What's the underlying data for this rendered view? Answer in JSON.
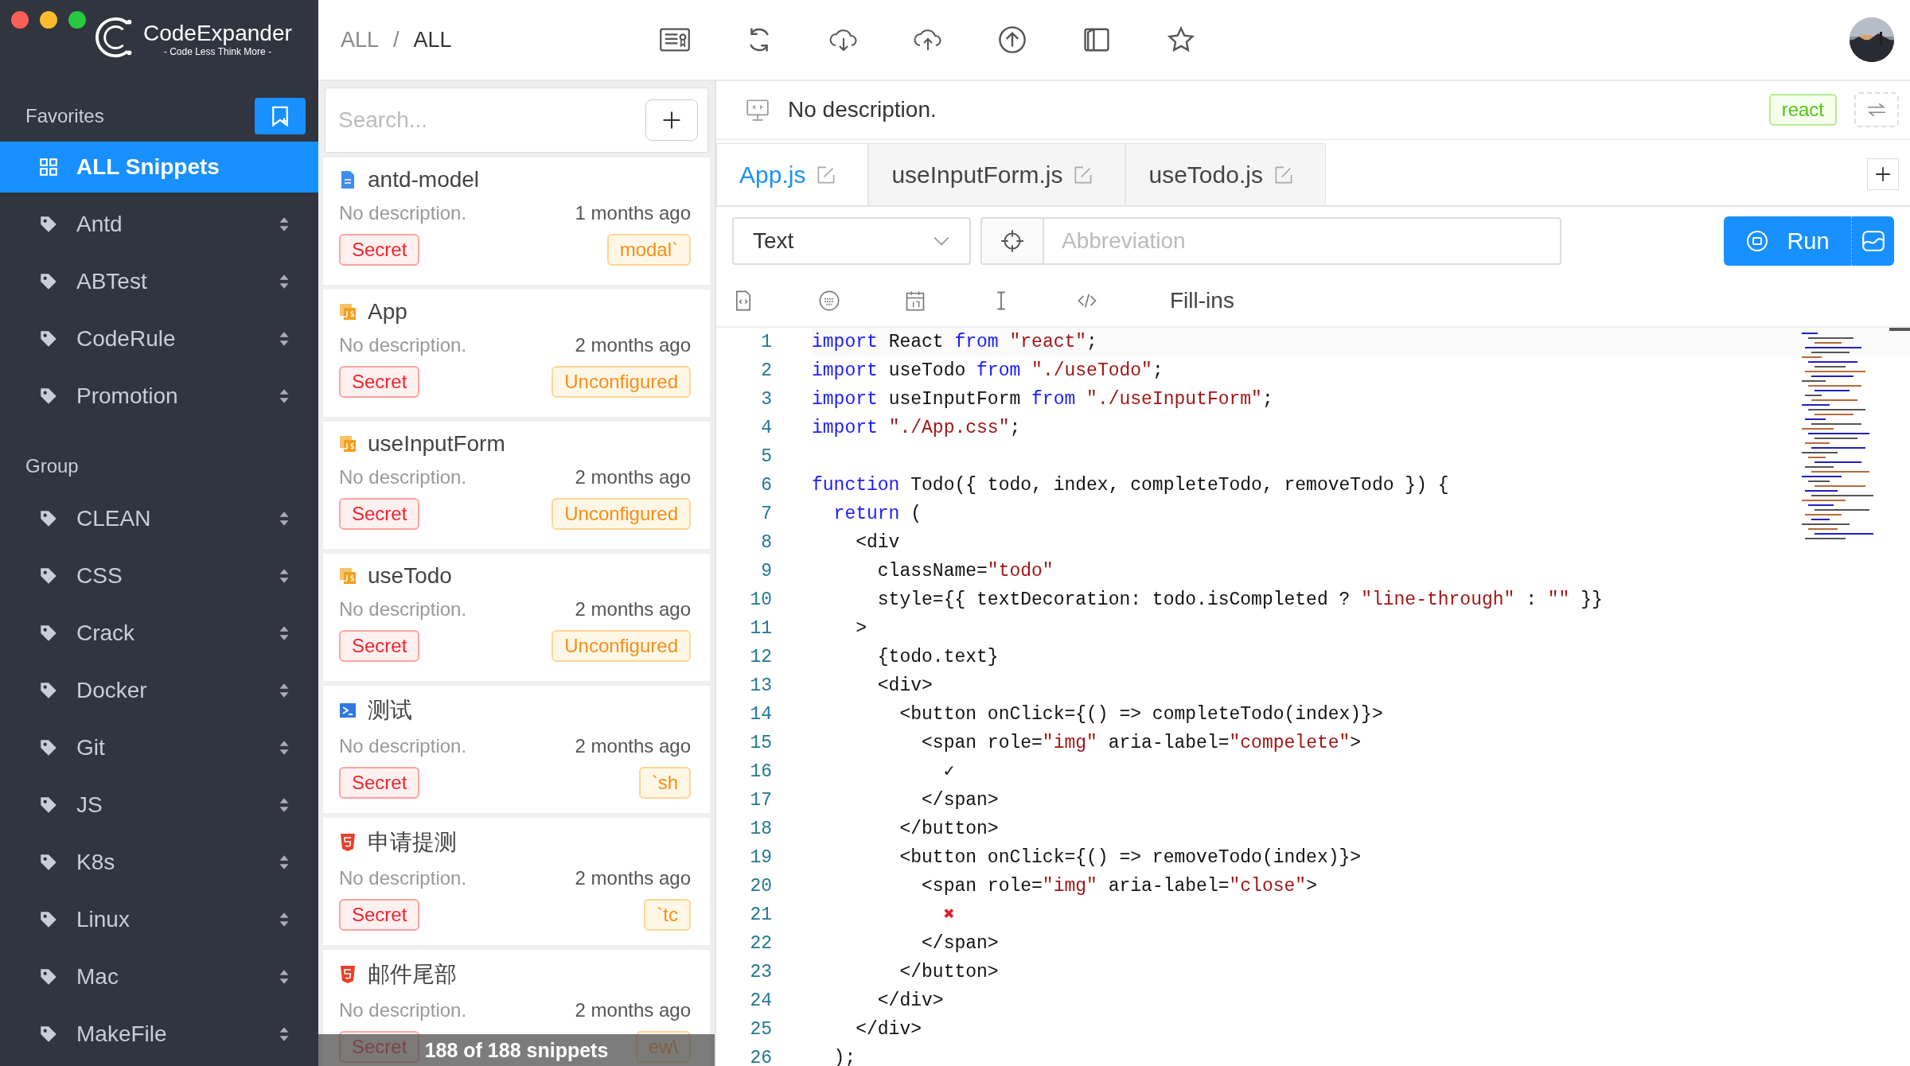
{
  "app": {
    "name": "CodeExpander",
    "slogan": "- Code Less Think More -"
  },
  "sidebar": {
    "favorites_title": "Favorites",
    "favorites": [
      {
        "label": "ALL Snippets",
        "kind": "grid",
        "selected": true
      },
      {
        "label": "Antd",
        "kind": "tag",
        "selected": false
      },
      {
        "label": "ABTest",
        "kind": "tag",
        "selected": false
      },
      {
        "label": "CodeRule",
        "kind": "tag",
        "selected": false
      },
      {
        "label": "Promotion",
        "kind": "tag",
        "selected": false
      }
    ],
    "group_title": "Group",
    "groups": [
      {
        "label": "CLEAN",
        "selected": false
      },
      {
        "label": "CSS",
        "selected": false
      },
      {
        "label": "Crack",
        "selected": false
      },
      {
        "label": "Docker",
        "selected": false
      },
      {
        "label": "Git",
        "selected": false
      },
      {
        "label": "JS",
        "selected": false
      },
      {
        "label": "K8s",
        "selected": false
      },
      {
        "label": "Linux",
        "selected": false
      },
      {
        "label": "Mac",
        "selected": false
      },
      {
        "label": "MakeFile",
        "selected": false
      }
    ]
  },
  "breadcrumb": [
    "ALL",
    "/",
    "ALL"
  ],
  "search": {
    "placeholder": "Search..."
  },
  "snippets": [
    {
      "kind": "doc",
      "title": "antd-model",
      "description": "No description.",
      "time": "1 months ago",
      "visibility": "Secret",
      "abbreviation": "modal`"
    },
    {
      "kind": "js",
      "title": "App",
      "description": "No description.",
      "time": "2 months ago",
      "visibility": "Secret",
      "abbreviation": "Unconfigured"
    },
    {
      "kind": "js",
      "title": "useInputForm",
      "description": "No description.",
      "time": "2 months ago",
      "visibility": "Secret",
      "abbreviation": "Unconfigured"
    },
    {
      "kind": "js",
      "title": "useTodo",
      "description": "No description.",
      "time": "2 months ago",
      "visibility": "Secret",
      "abbreviation": "Unconfigured"
    },
    {
      "kind": "shell",
      "title": "测试",
      "description": "No description.",
      "time": "2 months ago",
      "visibility": "Secret",
      "abbreviation": "`sh"
    },
    {
      "kind": "html",
      "title": "申请提测",
      "description": "No description.",
      "time": "2 months ago",
      "visibility": "Secret",
      "abbreviation": "`tc"
    },
    {
      "kind": "html",
      "title": "邮件尾部",
      "description": "No description.",
      "time": "2 months ago",
      "visibility": "Secret",
      "abbreviation": "ew\\"
    }
  ],
  "list_footer": "188 of 188 snippets",
  "editor": {
    "description": "No description.",
    "language_tag": "react",
    "tabs": [
      {
        "label": "App.js",
        "selected": true
      },
      {
        "label": "useInputForm.js",
        "selected": false
      },
      {
        "label": "useTodo.js",
        "selected": false
      }
    ],
    "type_select": "Text",
    "abbreviation": {
      "placeholder": "Abbreviation"
    },
    "run_button": "Run",
    "fill_ins": "Fill-ins",
    "lines": [
      {
        "number": "1",
        "tokens": [
          {
            "kind": "kw",
            "text": "import"
          },
          {
            "kind": "plain",
            "text": " React "
          },
          {
            "kind": "kw",
            "text": "from"
          },
          {
            "kind": "str",
            "text": " \"react\""
          },
          {
            "kind": "plain",
            "text": ";"
          }
        ]
      },
      {
        "number": "2",
        "tokens": [
          {
            "kind": "kw",
            "text": "import"
          },
          {
            "kind": "plain",
            "text": " useTodo "
          },
          {
            "kind": "kw",
            "text": "from"
          },
          {
            "kind": "str",
            "text": " \"./useTodo\""
          },
          {
            "kind": "plain",
            "text": ";"
          }
        ]
      },
      {
        "number": "3",
        "tokens": [
          {
            "kind": "kw",
            "text": "import"
          },
          {
            "kind": "plain",
            "text": " useInputForm "
          },
          {
            "kind": "kw",
            "text": "from"
          },
          {
            "kind": "str",
            "text": " \"./useInputForm\""
          },
          {
            "kind": "plain",
            "text": ";"
          }
        ]
      },
      {
        "number": "4",
        "tokens": [
          {
            "kind": "kw",
            "text": "import"
          },
          {
            "kind": "str",
            "text": " \"./App.css\""
          },
          {
            "kind": "plain",
            "text": ";"
          }
        ]
      },
      {
        "number": "5"
      },
      {
        "number": "6",
        "tokens": [
          {
            "kind": "kw",
            "text": "function"
          },
          {
            "kind": "plain",
            "text": " Todo({ todo, index, completeTodo, removeTodo }) {"
          }
        ]
      },
      {
        "number": "7",
        "tokens": [
          {
            "kind": "kw",
            "text": "  return"
          },
          {
            "kind": "plain",
            "text": " ("
          }
        ]
      },
      {
        "number": "8",
        "tokens": [
          {
            "kind": "plain",
            "text": "    <div"
          }
        ]
      },
      {
        "number": "9",
        "tokens": [
          {
            "kind": "plain",
            "text": "      className="
          },
          {
            "kind": "str",
            "text": "\"todo\""
          }
        ]
      },
      {
        "number": "10",
        "tokens": [
          {
            "kind": "plain",
            "text": "      style={{ textDecoration: todo.isCompleted ? "
          },
          {
            "kind": "str",
            "text": "\"line-through\""
          },
          {
            "kind": "plain",
            "text": " : "
          },
          {
            "kind": "str",
            "text": "\"\""
          },
          {
            "kind": "plain",
            "text": " }}"
          }
        ]
      },
      {
        "number": "11",
        "tokens": [
          {
            "kind": "plain",
            "text": "    >"
          }
        ]
      },
      {
        "number": "12",
        "tokens": [
          {
            "kind": "plain",
            "text": "      {todo.text}"
          }
        ]
      },
      {
        "number": "13",
        "tokens": [
          {
            "kind": "plain",
            "text": "      <div>"
          }
        ]
      },
      {
        "number": "14",
        "tokens": [
          {
            "kind": "plain",
            "text": "        <button onClick={() => completeTodo(index)}>"
          }
        ]
      },
      {
        "number": "15",
        "tokens": [
          {
            "kind": "plain",
            "text": "          <span role="
          },
          {
            "kind": "str",
            "text": "\"img\""
          },
          {
            "kind": "plain",
            "text": " aria-label="
          },
          {
            "kind": "str",
            "text": "\"compelete\""
          },
          {
            "kind": "plain",
            "text": ">"
          }
        ]
      },
      {
        "number": "16",
        "tokens": [
          {
            "kind": "plain",
            "text": "            ✓"
          }
        ]
      },
      {
        "number": "17",
        "tokens": [
          {
            "kind": "plain",
            "text": "          </span>"
          }
        ]
      },
      {
        "number": "18",
        "tokens": [
          {
            "kind": "plain",
            "text": "        </button>"
          }
        ]
      },
      {
        "number": "19",
        "tokens": [
          {
            "kind": "plain",
            "text": "        <button onClick={() => removeTodo(index)}>"
          }
        ]
      },
      {
        "number": "20",
        "tokens": [
          {
            "kind": "plain",
            "text": "          <span role="
          },
          {
            "kind": "str",
            "text": "\"img\""
          },
          {
            "kind": "plain",
            "text": " aria-label="
          },
          {
            "kind": "str",
            "text": "\"close\""
          },
          {
            "kind": "plain",
            "text": ">"
          }
        ]
      },
      {
        "number": "21",
        "tokens": [
          {
            "kind": "cross",
            "text": "            ✖"
          }
        ]
      },
      {
        "number": "22",
        "tokens": [
          {
            "kind": "plain",
            "text": "          </span>"
          }
        ]
      },
      {
        "number": "23",
        "tokens": [
          {
            "kind": "plain",
            "text": "        </button>"
          }
        ]
      },
      {
        "number": "24",
        "tokens": [
          {
            "kind": "plain",
            "text": "      </div>"
          }
        ]
      },
      {
        "number": "25",
        "tokens": [
          {
            "kind": "plain",
            "text": "    </div>"
          }
        ]
      },
      {
        "number": "26",
        "tokens": [
          {
            "kind": "plain",
            "text": "  );"
          }
        ]
      }
    ]
  }
}
